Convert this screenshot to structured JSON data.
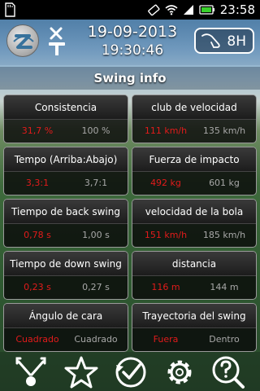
{
  "status_bar": {
    "time": "23:58"
  },
  "header": {
    "date": "19-09-2013",
    "time": "19:30:46",
    "club": "8H"
  },
  "title": "Swing info",
  "cards": [
    {
      "label": "Consistencia",
      "value_current": "31,7 %",
      "value_reference": "100 %"
    },
    {
      "label": "club de velocidad",
      "value_current": "111 km/h",
      "value_reference": "135 km/h"
    },
    {
      "label": "Tempo (Arriba:Abajo)",
      "value_current": "3,3:1",
      "value_reference": "3,7:1"
    },
    {
      "label": "Fuerza de impacto",
      "value_current": "492 kg",
      "value_reference": "601 kg"
    },
    {
      "label": "Tiempo de back swing",
      "value_current": "0,78 s",
      "value_reference": "1,00 s"
    },
    {
      "label": "velocidad de la bola",
      "value_current": "151 km/h",
      "value_reference": "185 km/h"
    },
    {
      "label": "Tiempo de down swing",
      "value_current": "0,23 s",
      "value_reference": "0,27 s"
    },
    {
      "label": "distancia",
      "value_current": "116 m",
      "value_reference": "144 m"
    },
    {
      "label": "Ángulo de cara",
      "value_current": "Cuadrado",
      "value_reference": "Cuadrado"
    },
    {
      "label": "Trayectoria del swing",
      "value_current": "Fuera",
      "value_reference": "Dentro"
    }
  ],
  "nav": [
    "swing-path-icon",
    "star-icon",
    "history-check-icon",
    "gear-icon",
    "help-icon"
  ],
  "colors": {
    "current_value": "#e21b1b",
    "reference_value": "#a8a8a8"
  }
}
